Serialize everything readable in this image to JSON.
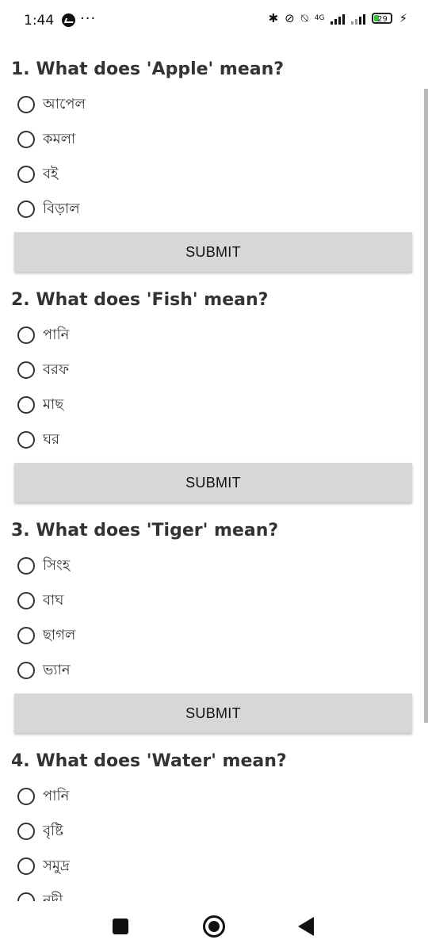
{
  "status_bar": {
    "time": "1:44",
    "dots": "···",
    "battery_level": "29",
    "network_label": "4G",
    "icons": [
      "messenger-icon",
      "bluetooth-icon",
      "link-icon",
      "vibrate-off-icon",
      "signal-icon",
      "signal-icon",
      "battery-icon",
      "charging-icon"
    ]
  },
  "questions": [
    {
      "title": "1. What does 'Apple' mean?",
      "options": [
        "আপেল",
        "কমলা",
        "বই",
        "বিড়াল"
      ],
      "submit_label": "SUBMIT"
    },
    {
      "title": "2. What does 'Fish' mean?",
      "options": [
        "পানি",
        "বরফ",
        "মাছ",
        "ঘর"
      ],
      "submit_label": "SUBMIT"
    },
    {
      "title": "3. What does 'Tiger' mean?",
      "options": [
        "সিংহ",
        "বাঘ",
        "ছাগল",
        "ভ্যান"
      ],
      "submit_label": "SUBMIT"
    },
    {
      "title": "4. What does 'Water' mean?",
      "options": [
        "পানি",
        "বৃষ্টি",
        "সমুদ্র",
        "নদী"
      ]
    }
  ],
  "nav_bar": {
    "icons": [
      "recents-icon",
      "home-icon",
      "back-icon"
    ]
  },
  "colors": {
    "button_bg": "#d6d7d8",
    "text": "#333333",
    "battery_fill": "#3cbf3c"
  }
}
